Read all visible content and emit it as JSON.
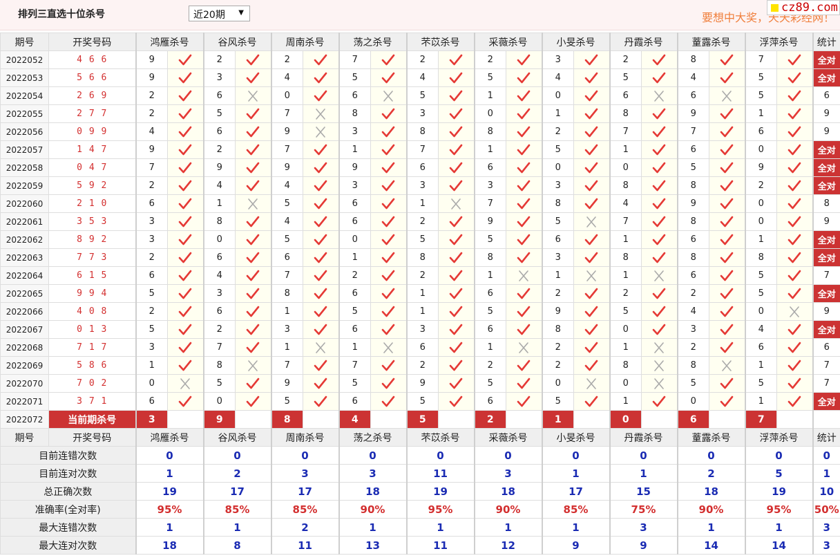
{
  "header": {
    "title": "排列三直选十位杀号",
    "period_select": "近20期",
    "slogan": "要想中大奖，天天彩经网！",
    "site_badge": "cz89.com"
  },
  "columns": {
    "issue": "期号",
    "draw": "开奖号码",
    "experts": [
      "鸿雁杀号",
      "谷风杀号",
      "周南杀号",
      "荡之杀号",
      "芣苡杀号",
      "采薇杀号",
      "小旻杀号",
      "丹霞杀号",
      "蕫露杀号",
      "浮萍杀号"
    ],
    "stat": "统计"
  },
  "icons": {
    "correct": "check-icon",
    "wrong": "cross-icon"
  },
  "colors": {
    "accent": "#cc3333",
    "check": "#e53935",
    "cross": "#aaaaaa",
    "number_blue": "#1a2bb3",
    "draw_red": "#d32f2f"
  },
  "rows": [
    {
      "issue": "2022052",
      "draw": "4 6 6",
      "picks": [
        "9",
        "2",
        "2",
        "7",
        "2",
        "2",
        "3",
        "2",
        "8",
        "7"
      ],
      "marks": [
        1,
        1,
        1,
        1,
        1,
        1,
        1,
        1,
        1,
        1
      ],
      "stat": "全对"
    },
    {
      "issue": "2022053",
      "draw": "5 6 6",
      "picks": [
        "9",
        "3",
        "4",
        "5",
        "4",
        "5",
        "4",
        "5",
        "4",
        "5"
      ],
      "marks": [
        1,
        1,
        1,
        1,
        1,
        1,
        1,
        1,
        1,
        1
      ],
      "stat": "全对"
    },
    {
      "issue": "2022054",
      "draw": "2 6 9",
      "picks": [
        "2",
        "6",
        "0",
        "6",
        "5",
        "1",
        "0",
        "6",
        "6",
        "5"
      ],
      "marks": [
        1,
        0,
        1,
        0,
        1,
        1,
        1,
        0,
        0,
        1
      ],
      "stat": "6"
    },
    {
      "issue": "2022055",
      "draw": "2 7 7",
      "picks": [
        "2",
        "5",
        "7",
        "8",
        "3",
        "0",
        "1",
        "8",
        "9",
        "1"
      ],
      "marks": [
        1,
        1,
        0,
        1,
        1,
        1,
        1,
        1,
        1,
        1
      ],
      "stat": "9"
    },
    {
      "issue": "2022056",
      "draw": "0 9 9",
      "picks": [
        "4",
        "6",
        "9",
        "3",
        "8",
        "8",
        "2",
        "7",
        "7",
        "6"
      ],
      "marks": [
        1,
        1,
        0,
        1,
        1,
        1,
        1,
        1,
        1,
        1
      ],
      "stat": "9"
    },
    {
      "issue": "2022057",
      "draw": "1 4 7",
      "picks": [
        "9",
        "2",
        "7",
        "1",
        "7",
        "1",
        "5",
        "1",
        "6",
        "0"
      ],
      "marks": [
        1,
        1,
        1,
        1,
        1,
        1,
        1,
        1,
        1,
        1
      ],
      "stat": "全对"
    },
    {
      "issue": "2022058",
      "draw": "0 4 7",
      "picks": [
        "7",
        "9",
        "9",
        "9",
        "6",
        "6",
        "0",
        "0",
        "5",
        "9"
      ],
      "marks": [
        1,
        1,
        1,
        1,
        1,
        1,
        1,
        1,
        1,
        1
      ],
      "stat": "全对"
    },
    {
      "issue": "2022059",
      "draw": "5 9 2",
      "picks": [
        "2",
        "4",
        "4",
        "3",
        "3",
        "3",
        "3",
        "8",
        "8",
        "2"
      ],
      "marks": [
        1,
        1,
        1,
        1,
        1,
        1,
        1,
        1,
        1,
        1
      ],
      "stat": "全对"
    },
    {
      "issue": "2022060",
      "draw": "2 1 0",
      "picks": [
        "6",
        "1",
        "5",
        "6",
        "1",
        "7",
        "8",
        "4",
        "9",
        "0"
      ],
      "marks": [
        1,
        0,
        1,
        1,
        0,
        1,
        1,
        1,
        1,
        1
      ],
      "stat": "8"
    },
    {
      "issue": "2022061",
      "draw": "3 5 3",
      "picks": [
        "3",
        "8",
        "4",
        "6",
        "2",
        "9",
        "5",
        "7",
        "8",
        "0"
      ],
      "marks": [
        1,
        1,
        1,
        1,
        1,
        1,
        0,
        1,
        1,
        1
      ],
      "stat": "9"
    },
    {
      "issue": "2022062",
      "draw": "8 9 2",
      "picks": [
        "3",
        "0",
        "5",
        "0",
        "5",
        "5",
        "6",
        "1",
        "6",
        "1"
      ],
      "marks": [
        1,
        1,
        1,
        1,
        1,
        1,
        1,
        1,
        1,
        1
      ],
      "stat": "全对"
    },
    {
      "issue": "2022063",
      "draw": "7 7 3",
      "picks": [
        "2",
        "6",
        "6",
        "1",
        "8",
        "8",
        "3",
        "8",
        "8",
        "8"
      ],
      "marks": [
        1,
        1,
        1,
        1,
        1,
        1,
        1,
        1,
        1,
        1
      ],
      "stat": "全对"
    },
    {
      "issue": "2022064",
      "draw": "6 1 5",
      "picks": [
        "6",
        "4",
        "7",
        "2",
        "2",
        "1",
        "1",
        "1",
        "6",
        "5"
      ],
      "marks": [
        1,
        1,
        1,
        1,
        1,
        0,
        0,
        0,
        1,
        1
      ],
      "stat": "7"
    },
    {
      "issue": "2022065",
      "draw": "9 9 4",
      "picks": [
        "5",
        "3",
        "8",
        "6",
        "1",
        "6",
        "2",
        "2",
        "2",
        "5"
      ],
      "marks": [
        1,
        1,
        1,
        1,
        1,
        1,
        1,
        1,
        1,
        1
      ],
      "stat": "全对"
    },
    {
      "issue": "2022066",
      "draw": "4 0 8",
      "picks": [
        "2",
        "6",
        "1",
        "5",
        "1",
        "5",
        "9",
        "5",
        "4",
        "0"
      ],
      "marks": [
        1,
        1,
        1,
        1,
        1,
        1,
        1,
        1,
        1,
        0
      ],
      "stat": "9"
    },
    {
      "issue": "2022067",
      "draw": "0 1 3",
      "picks": [
        "5",
        "2",
        "3",
        "6",
        "3",
        "6",
        "8",
        "0",
        "3",
        "4"
      ],
      "marks": [
        1,
        1,
        1,
        1,
        1,
        1,
        1,
        1,
        1,
        1
      ],
      "stat": "全对"
    },
    {
      "issue": "2022068",
      "draw": "7 1 7",
      "picks": [
        "3",
        "7",
        "1",
        "1",
        "6",
        "1",
        "2",
        "1",
        "2",
        "6"
      ],
      "marks": [
        1,
        1,
        0,
        0,
        1,
        0,
        1,
        0,
        1,
        1
      ],
      "stat": "6"
    },
    {
      "issue": "2022069",
      "draw": "5 8 6",
      "picks": [
        "1",
        "8",
        "7",
        "7",
        "2",
        "2",
        "2",
        "8",
        "8",
        "1"
      ],
      "marks": [
        1,
        0,
        1,
        1,
        1,
        1,
        1,
        0,
        0,
        1
      ],
      "stat": "7"
    },
    {
      "issue": "2022070",
      "draw": "7 0 2",
      "picks": [
        "0",
        "5",
        "9",
        "5",
        "9",
        "5",
        "0",
        "0",
        "5",
        "5"
      ],
      "marks": [
        0,
        1,
        1,
        1,
        1,
        1,
        0,
        0,
        1,
        1
      ],
      "stat": "7"
    },
    {
      "issue": "2022071",
      "draw": "3 7 1",
      "picks": [
        "6",
        "0",
        "5",
        "6",
        "5",
        "6",
        "5",
        "1",
        "0",
        "1"
      ],
      "marks": [
        1,
        1,
        1,
        1,
        1,
        1,
        1,
        1,
        1,
        1
      ],
      "stat": "全对"
    }
  ],
  "current": {
    "issue": "2022072",
    "label": "当前期杀号",
    "picks": [
      "3",
      "9",
      "8",
      "4",
      "5",
      "2",
      "1",
      "0",
      "6",
      "7"
    ]
  },
  "summary": [
    {
      "label": "目前连错次数",
      "values": [
        "0",
        "0",
        "0",
        "0",
        "0",
        "0",
        "0",
        "0",
        "0",
        "0"
      ],
      "stat": "0"
    },
    {
      "label": "目前连对次数",
      "values": [
        "1",
        "2",
        "3",
        "3",
        "11",
        "3",
        "1",
        "1",
        "2",
        "5"
      ],
      "stat": "1"
    },
    {
      "label": "总正确次数",
      "values": [
        "19",
        "17",
        "17",
        "18",
        "19",
        "18",
        "17",
        "15",
        "18",
        "19"
      ],
      "stat": "10"
    },
    {
      "label": "准确率(全对率)",
      "values": [
        "95%",
        "85%",
        "85%",
        "90%",
        "95%",
        "90%",
        "85%",
        "75%",
        "90%",
        "95%"
      ],
      "stat": "50%",
      "rate": true
    },
    {
      "label": "最大连错次数",
      "values": [
        "1",
        "1",
        "2",
        "1",
        "1",
        "1",
        "1",
        "3",
        "1",
        "1"
      ],
      "stat": "3"
    },
    {
      "label": "最大连对次数",
      "values": [
        "18",
        "8",
        "11",
        "13",
        "11",
        "12",
        "9",
        "9",
        "14",
        "14"
      ],
      "stat": "3"
    }
  ]
}
